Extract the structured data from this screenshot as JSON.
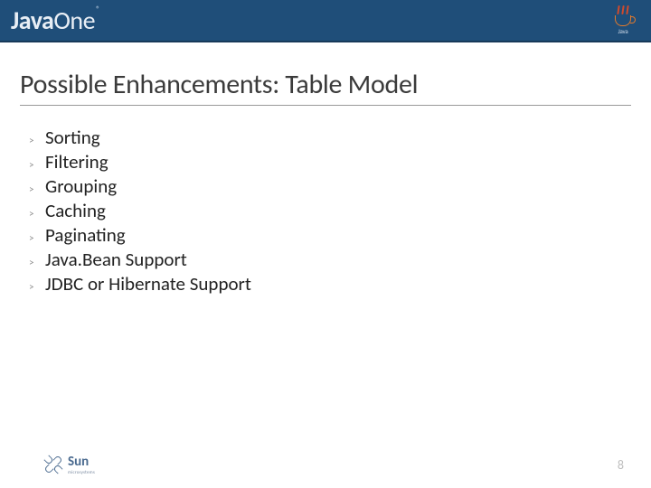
{
  "header": {
    "logo_main": "Java",
    "logo_sub": "One",
    "logo_reg": "®",
    "java_label": "Java"
  },
  "slide": {
    "title": "Possible Enhancements: Table Model",
    "bullet_marker": ">",
    "items": [
      "Sorting",
      "Filtering",
      "Grouping",
      "Caching",
      "Paginating",
      "Java.Bean Support",
      "JDBC or Hibernate Support"
    ]
  },
  "footer": {
    "sun_text": "Sun",
    "sun_sub": "microsystems",
    "page_number": "8"
  }
}
